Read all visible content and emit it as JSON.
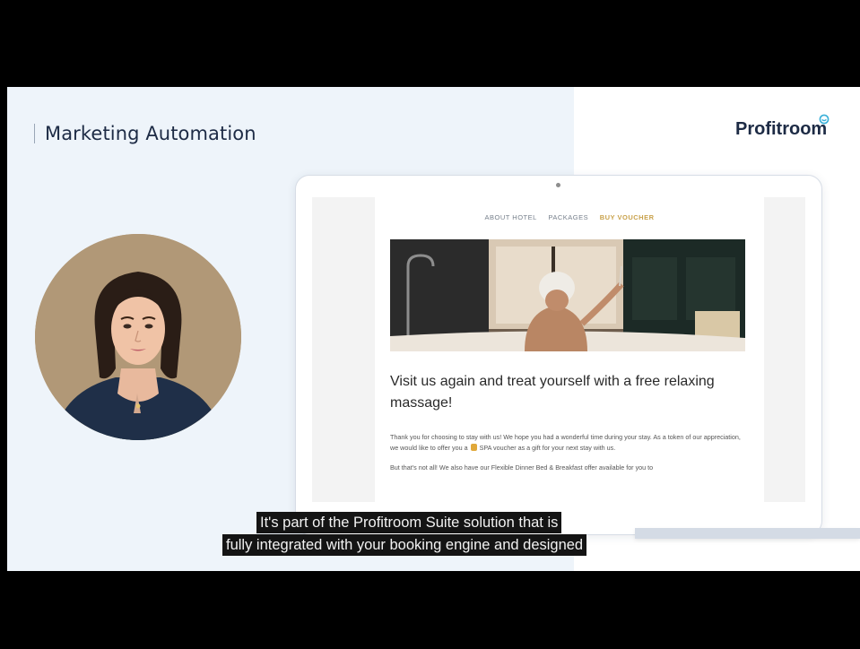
{
  "slide": {
    "title": "Marketing Automation",
    "logo": "Profitroom"
  },
  "email": {
    "nav": [
      "ABOUT HOTEL",
      "PACKAGES",
      "BUY VOUCHER"
    ],
    "headline": "Visit us again and treat yourself with a free relaxing massage!",
    "para1_a": "Thank you for choosing to stay with us! We hope you had a wonderful time during your stay. As a token of our appreciation, we would like to offer you a",
    "para1_b": "SPA voucher as a gift for your next stay with us.",
    "para2": "But that's not all! We also have our Flexible Dinner Bed & Breakfast offer available for you to"
  },
  "subtitles": {
    "line1": "It's part of the Profitroom Suite solution that is",
    "line2": "fully integrated with your booking engine and designed"
  },
  "colors": {
    "navy": "#1d2b45",
    "accent_gold": "#c9a24c",
    "logo_icon": "#3ab0d8"
  },
  "icons": [
    "logo-mark-icon",
    "gift-emoji-icon"
  ]
}
